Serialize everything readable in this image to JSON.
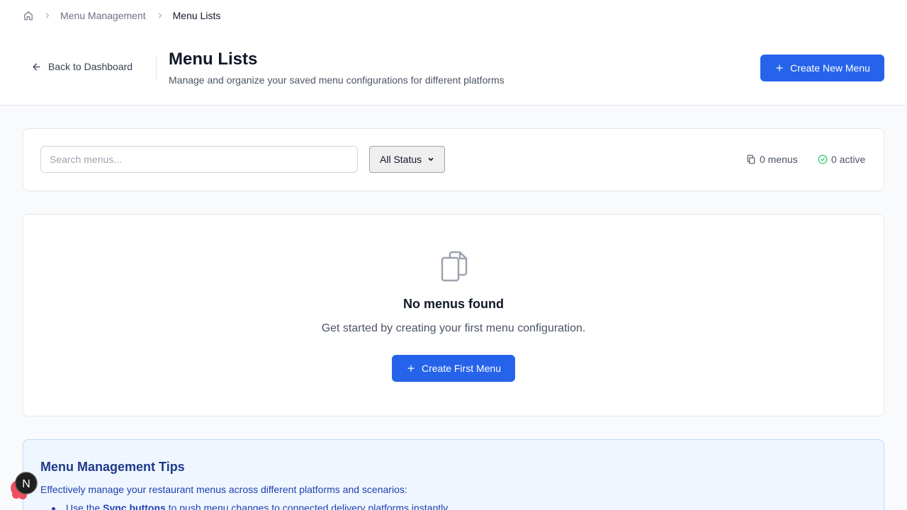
{
  "breadcrumb": {
    "home_icon": "home-icon",
    "items": [
      "Menu Management",
      "Menu Lists"
    ]
  },
  "header": {
    "back_label": "Back to Dashboard",
    "title": "Menu Lists",
    "subtitle": "Manage and organize your saved menu configurations for different platforms",
    "create_button": "Create New Menu"
  },
  "filters": {
    "search_placeholder": "Search menus...",
    "search_value": "",
    "status_selected": "All Status",
    "menus_count": "0 menus",
    "active_count": "0 active"
  },
  "empty_state": {
    "icon": "copy-icon",
    "title": "No menus found",
    "description": "Get started by creating your first menu configuration.",
    "button": "Create First Menu"
  },
  "tips": {
    "title": "Menu Management Tips",
    "intro": "Effectively manage your restaurant menus across different platforms and scenarios:",
    "item1_prefix": "Use the ",
    "item1_bold": "Sync buttons",
    "item1_suffix": " to push menu changes to connected delivery platforms instantly"
  },
  "dev_badge": {
    "letter": "N"
  },
  "colors": {
    "primary": "#2563eb",
    "success": "#22c55e",
    "tips_bg": "#eff6ff",
    "tips_text": "#1e40af"
  }
}
